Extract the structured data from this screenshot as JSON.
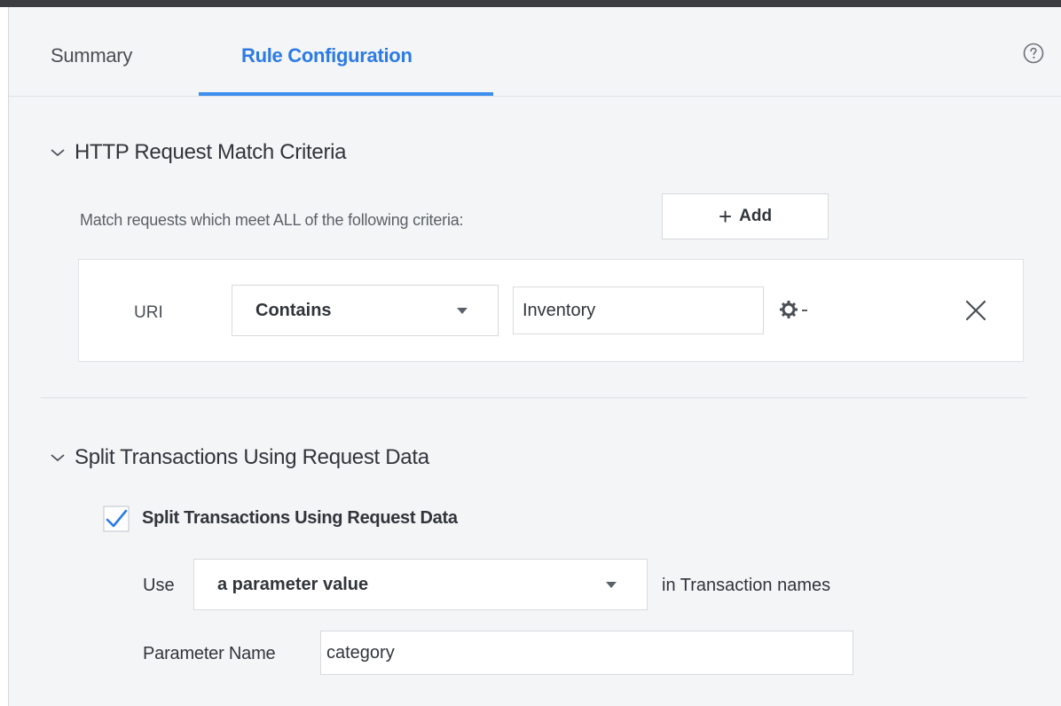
{
  "tabs": {
    "summary": "Summary",
    "rule_configuration": "Rule Configuration"
  },
  "icons": {
    "help": "help-circle-icon",
    "chevron": "chevron-down-icon",
    "plus": "plus-icon",
    "gear": "gear-icon",
    "close": "close-icon",
    "check": "checkmark-icon"
  },
  "match_criteria": {
    "title": "HTTP Request Match Criteria",
    "description": "Match requests which meet ALL of the following criteria:",
    "add_label": "Add",
    "criterion": {
      "field": "URI",
      "operator": "Contains",
      "value": "Inventory"
    }
  },
  "split": {
    "title": "Split Transactions Using Request Data",
    "checkbox_label": "Split Transactions Using Request Data",
    "checked": true,
    "use_label": "Use",
    "use_value": "a parameter value",
    "suffix": "in Transaction names",
    "param_name_label": "Parameter Name",
    "param_name_value": "category"
  },
  "colors": {
    "accent": "#2c7be5",
    "top_bar": "#3b3d40",
    "panel_bg": "#f4f5f7"
  }
}
